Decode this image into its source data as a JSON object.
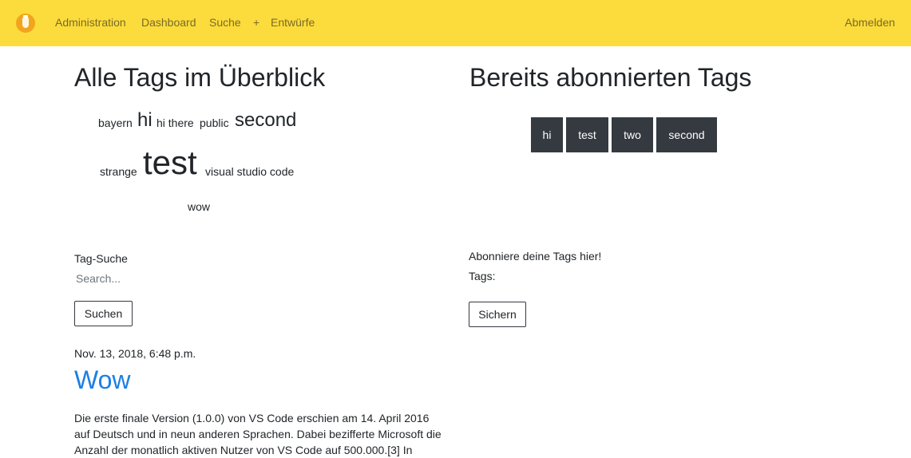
{
  "nav": {
    "items": [
      "Administration",
      "Dashboard",
      "Suche",
      "+",
      "Entwürfe"
    ],
    "logout": "Abmelden"
  },
  "tag_cloud": {
    "title": "Alle Tags im Überblick",
    "tags": [
      "bayern",
      "hi",
      "hi there",
      "public",
      "second",
      "strange",
      "test",
      "visual studio code",
      "wow"
    ]
  },
  "subscribed": {
    "title": "Bereits abonnierten Tags",
    "tags": [
      "hi",
      "test",
      "two",
      "second"
    ]
  },
  "search": {
    "label": "Tag-Suche",
    "placeholder": "Search...",
    "button": "Suchen"
  },
  "subscribe": {
    "heading": "Abonniere deine Tags hier!",
    "tags_label": "Tags:",
    "button": "Sichern"
  },
  "post": {
    "date": "Nov. 13, 2018, 6:48 p.m.",
    "title": "Wow",
    "body": "Die erste finale Version (1.0.0) von VS Code erschien am 14. April 2016 auf Deutsch und in neun anderen Sprachen. Dabei bezifferte Microsoft die Anzahl der monatlich aktiven Nutzer von VS Code auf 500.000.[3] In"
  }
}
